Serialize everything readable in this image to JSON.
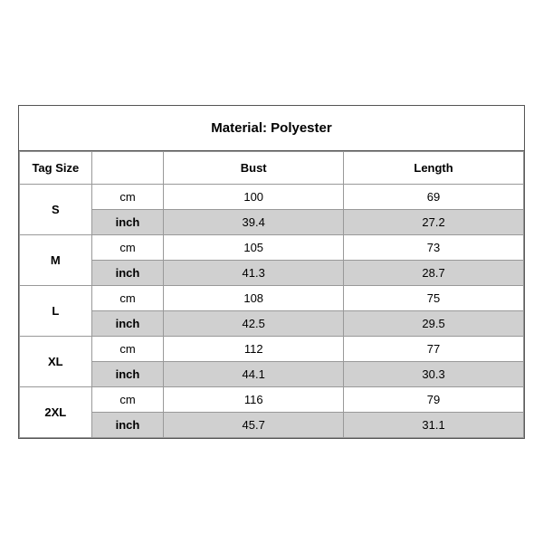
{
  "title": "Material: Polyester",
  "columns": {
    "tagSize": "Tag Size",
    "bust": "Bust",
    "length": "Length"
  },
  "sizes": [
    {
      "tag": "S",
      "cm": {
        "bust": "100",
        "length": "69"
      },
      "inch": {
        "bust": "39.4",
        "length": "27.2"
      }
    },
    {
      "tag": "M",
      "cm": {
        "bust": "105",
        "length": "73"
      },
      "inch": {
        "bust": "41.3",
        "length": "28.7"
      }
    },
    {
      "tag": "L",
      "cm": {
        "bust": "108",
        "length": "75"
      },
      "inch": {
        "bust": "42.5",
        "length": "29.5"
      }
    },
    {
      "tag": "XL",
      "cm": {
        "bust": "112",
        "length": "77"
      },
      "inch": {
        "bust": "44.1",
        "length": "30.3"
      }
    },
    {
      "tag": "2XL",
      "cm": {
        "bust": "116",
        "length": "79"
      },
      "inch": {
        "bust": "45.7",
        "length": "31.1"
      }
    }
  ],
  "labels": {
    "cm": "cm",
    "inch": "inch"
  }
}
